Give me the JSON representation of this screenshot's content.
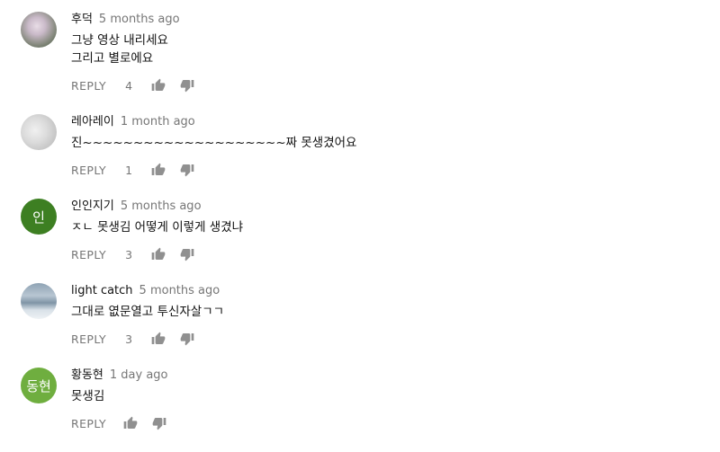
{
  "comments": [
    {
      "author": "후덕",
      "time": "5 months ago",
      "text": "그냥  영상  내리세요\n그리고 별로에요",
      "reply_label": "REPLY",
      "likes": "4",
      "avatar_type": "photo",
      "avatar_letter": ""
    },
    {
      "author": "레아레이",
      "time": "1 month ago",
      "text": "진~~~~~~~~~~~~~~~~~~~~짜 못생겼어요",
      "reply_label": "REPLY",
      "likes": "1",
      "avatar_type": "photo",
      "avatar_letter": ""
    },
    {
      "author": "인인지기",
      "time": "5 months ago",
      "text": "ㅈㄴ 못생김 어떻게 이렇게 생겼냐",
      "reply_label": "REPLY",
      "likes": "3",
      "avatar_type": "letter",
      "avatar_letter": "인",
      "avatar_color": "#3d7f22"
    },
    {
      "author": "light catch",
      "time": "5 months ago",
      "text": "그대로 엾문열고 투신자살ㄱㄱ",
      "reply_label": "REPLY",
      "likes": "3",
      "avatar_type": "photo",
      "avatar_letter": ""
    },
    {
      "author": "황동현",
      "time": "1 day ago",
      "text": "못생김",
      "reply_label": "REPLY",
      "likes": "",
      "avatar_type": "letter",
      "avatar_letter": "동현",
      "avatar_color": "#6fae3f"
    }
  ],
  "icons": {
    "like": "thumbs-up-icon",
    "dislike": "thumbs-down-icon"
  }
}
